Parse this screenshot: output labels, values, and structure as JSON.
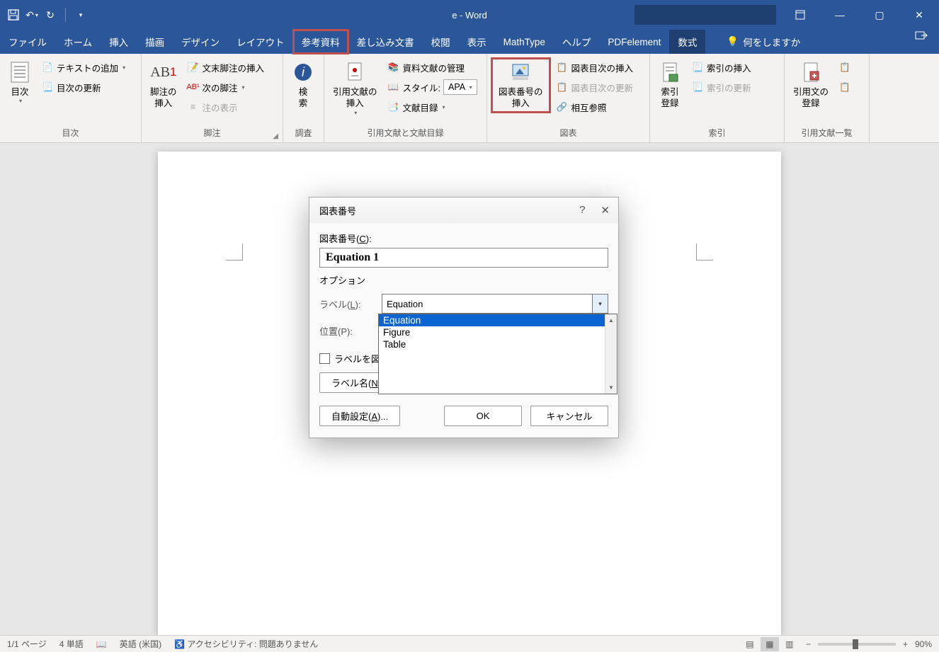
{
  "titlebar": {
    "doc_title": "e  -  Word"
  },
  "tabs": {
    "file": "ファイル",
    "home": "ホーム",
    "insert": "挿入",
    "draw": "描画",
    "design": "デザイン",
    "layout": "レイアウト",
    "references": "参考資料",
    "mailmerge": "差し込み文書",
    "review": "校閲",
    "view": "表示",
    "mathtype": "MathType",
    "help": "ヘルプ",
    "pdfelement": "PDFelement",
    "equation": "数式",
    "tellme": "何をしますか"
  },
  "ribbon": {
    "toc": {
      "main": "目次",
      "add_text": "テキストの追加",
      "update": "目次の更新",
      "group": "目次"
    },
    "footnote": {
      "insert_main": "脚注の\n挿入",
      "endnote": "文末脚注の挿入",
      "next": "次の脚注",
      "show": "注の表示",
      "group": "脚注"
    },
    "research": {
      "search": "検\n索",
      "group": "調査"
    },
    "citation": {
      "insert_main": "引用文献の\n挿入",
      "manage": "資料文献の管理",
      "style_label": "スタイル:",
      "style_value": "APA",
      "bibliography": "文献目録",
      "group": "引用文献と文献目録"
    },
    "caption": {
      "insert_main": "図表番号の\n挿入",
      "tof": "図表目次の挿入",
      "update_tof": "図表目次の更新",
      "crossref": "相互参照",
      "group": "図表"
    },
    "index": {
      "mark_main": "索引\n登録",
      "insert_index": "索引の挿入",
      "update_index": "索引の更新",
      "group": "索引"
    },
    "authorities": {
      "mark_main": "引用文の\n登録",
      "group": "引用文献一覧"
    }
  },
  "dialog": {
    "title": "図表番号",
    "caption_label": "図表番号(",
    "caption_key": "C",
    "caption_label2": "):",
    "caption_value": "Equation 1",
    "options": "オプション",
    "label_row": "ラベル(",
    "label_key": "L",
    "label_row2": "):",
    "label_value": "Equation",
    "position_row": "位置(P):",
    "chk_label": "ラベルを図表",
    "new_label": "ラベル名(",
    "new_label_key": "N",
    "auto": "自動設定(",
    "auto_key": "A",
    "auto2": ")...",
    "ok": "OK",
    "cancel": "キャンセル",
    "dropdown": {
      "opt1": "Equation",
      "opt2": "Figure",
      "opt3": "Table"
    }
  },
  "status": {
    "page": "1/1 ページ",
    "words": "4 単語",
    "lang": "英語 (米国)",
    "accessibility": "アクセシビリティ: 問題ありません",
    "zoom": "90%"
  }
}
